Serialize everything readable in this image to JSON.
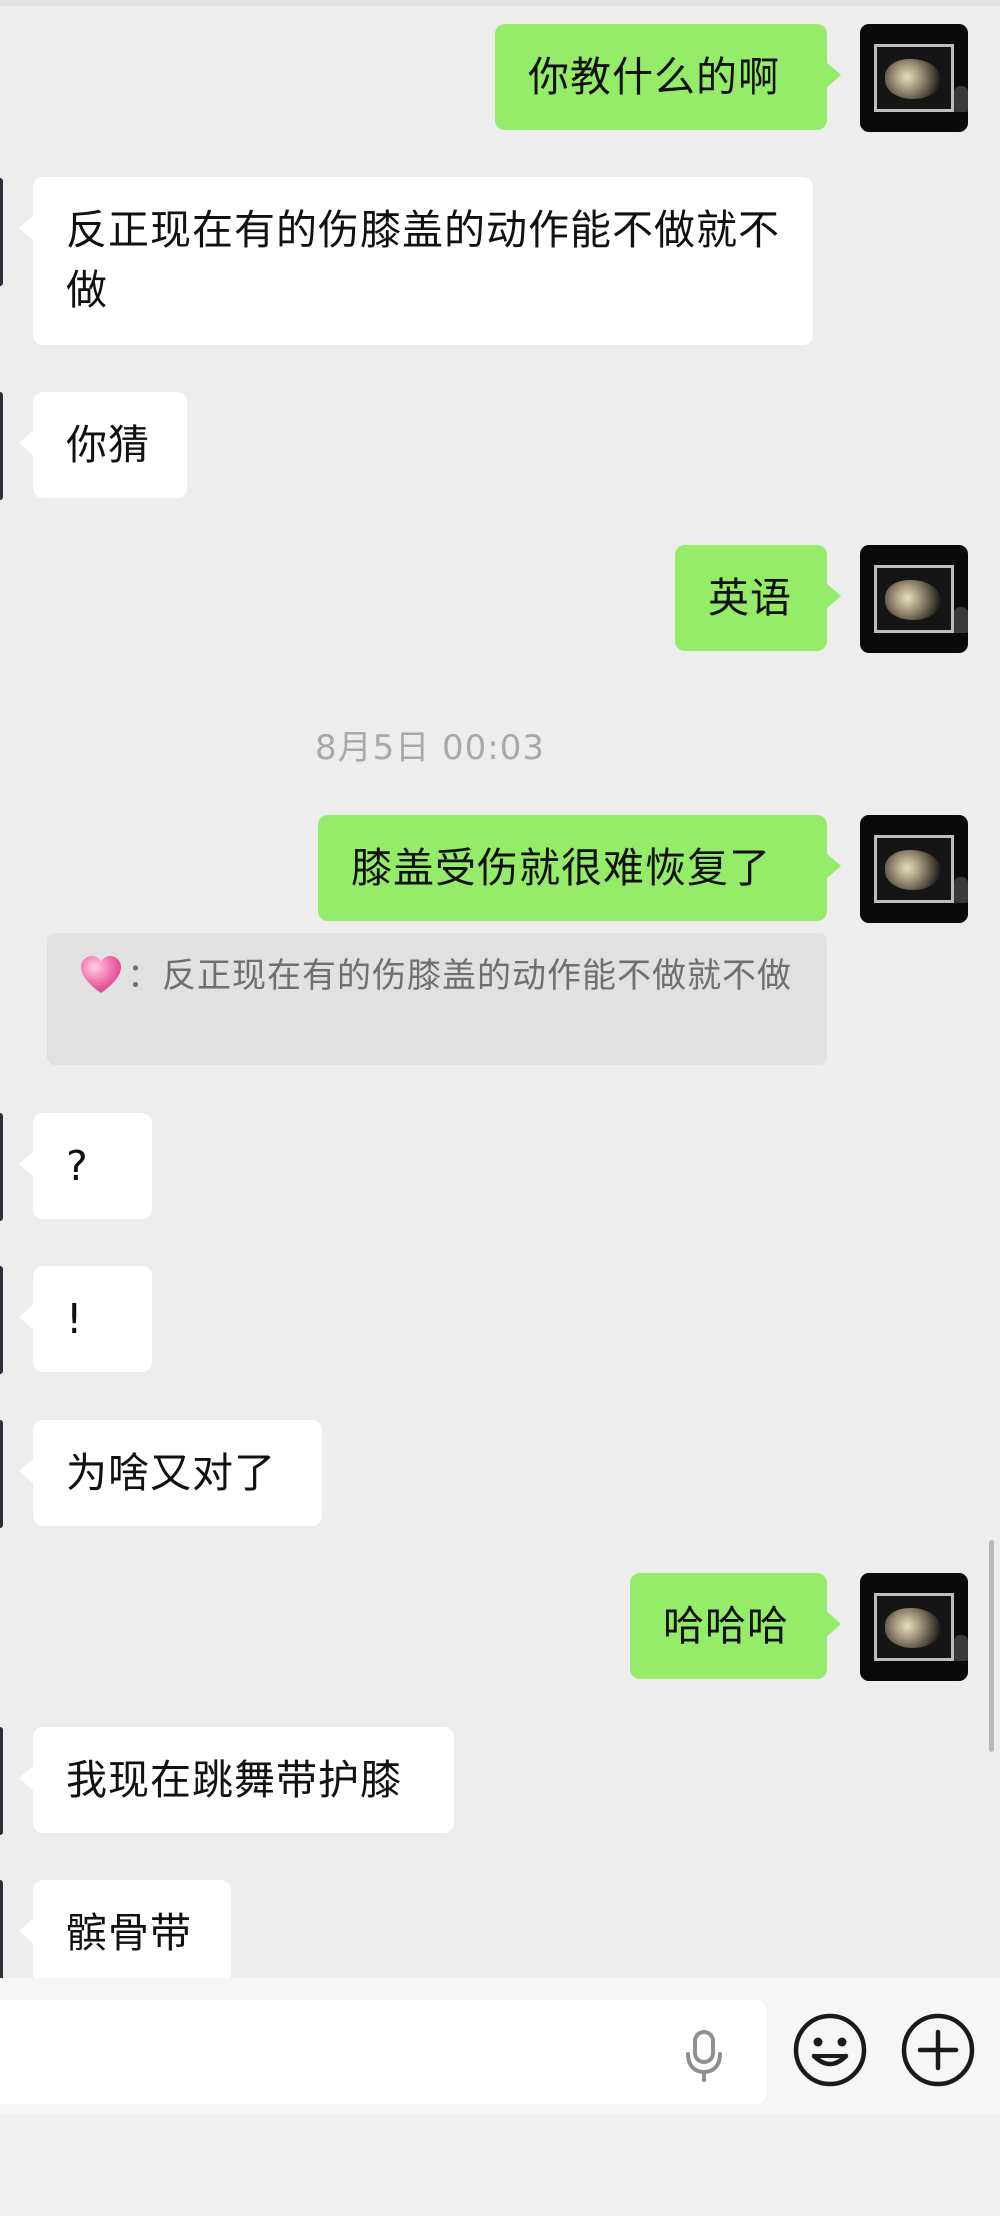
{
  "messages": {
    "m1": {
      "text": "你教什么的啊"
    },
    "m2": {
      "text": "反正现在有的伤膝盖的动作能不做就不做"
    },
    "m3": {
      "text": "你猜"
    },
    "m4": {
      "text": "英语"
    },
    "timestamp": "8月5日 00:03",
    "m5": {
      "text": "膝盖受伤就很难恢复了"
    },
    "quote": {
      "sender_icon": "pink-heart-emoji",
      "separator": "：",
      "text": "反正现在有的伤膝盖的动作能不做就不做"
    },
    "m6": {
      "text": "?"
    },
    "m7": {
      "text": "!"
    },
    "m8": {
      "text": "为啥又对了"
    },
    "m9": {
      "text": "哈哈哈"
    },
    "m10": {
      "text": "我现在跳舞带护膝"
    },
    "m11": {
      "text": "髌骨带"
    }
  },
  "input": {
    "value": "",
    "voice_icon": "microphone-icon",
    "emoji_icon": "smiley-icon",
    "more_icon": "plus-circle-icon"
  },
  "colors": {
    "sent_bubble": "#95ec69",
    "received_bubble": "#ffffff",
    "background": "#ededed",
    "timestamp_text": "#a8a8a8"
  }
}
